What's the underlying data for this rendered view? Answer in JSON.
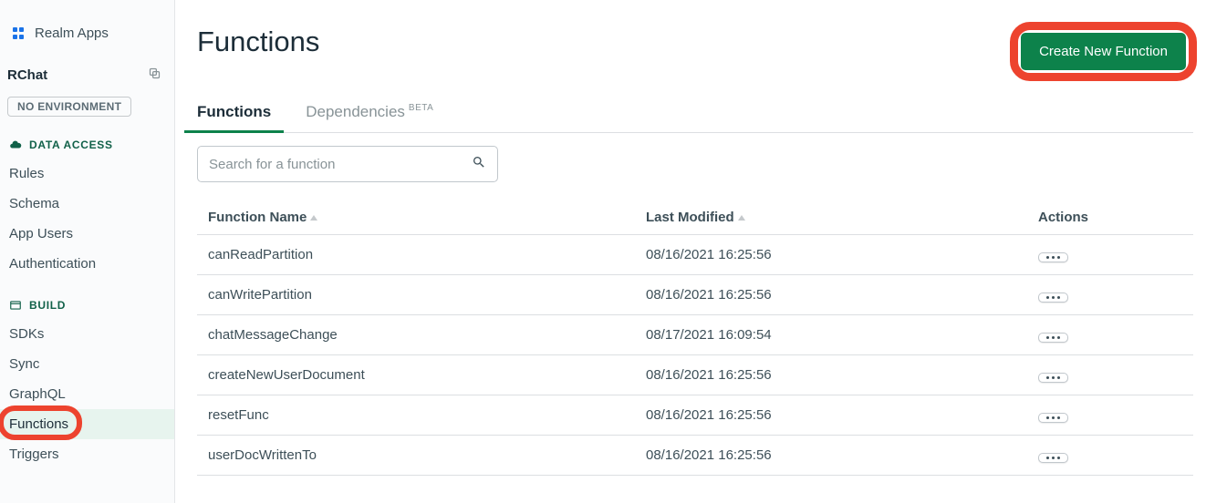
{
  "sidebar": {
    "realm_apps": "Realm Apps",
    "app_name": "RChat",
    "env_badge": "NO ENVIRONMENT",
    "sections": {
      "data_access": {
        "label": "DATA ACCESS",
        "items": [
          "Rules",
          "Schema",
          "App Users",
          "Authentication"
        ]
      },
      "build": {
        "label": "BUILD",
        "items": [
          "SDKs",
          "Sync",
          "GraphQL",
          "Functions",
          "Triggers"
        ]
      }
    }
  },
  "header": {
    "title": "Functions",
    "create_button": "Create New Function"
  },
  "tabs": {
    "functions": "Functions",
    "dependencies": "Dependencies",
    "beta": "BETA"
  },
  "search": {
    "placeholder": "Search for a function"
  },
  "table": {
    "columns": {
      "name": "Function Name",
      "modified": "Last Modified",
      "actions": "Actions"
    },
    "rows": [
      {
        "name": "canReadPartition",
        "modified": "08/16/2021 16:25:56"
      },
      {
        "name": "canWritePartition",
        "modified": "08/16/2021 16:25:56"
      },
      {
        "name": "chatMessageChange",
        "modified": "08/17/2021 16:09:54"
      },
      {
        "name": "createNewUserDocument",
        "modified": "08/16/2021 16:25:56"
      },
      {
        "name": "resetFunc",
        "modified": "08/16/2021 16:25:56"
      },
      {
        "name": "userDocWrittenTo",
        "modified": "08/16/2021 16:25:56"
      }
    ]
  }
}
